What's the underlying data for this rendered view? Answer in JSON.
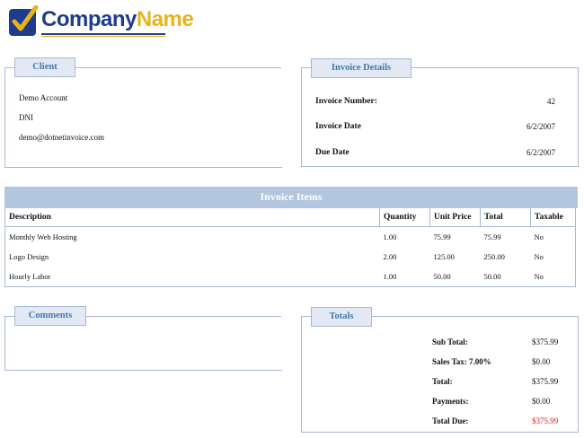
{
  "brand": {
    "company": "Company",
    "name": "Name"
  },
  "client": {
    "tab": "Client",
    "lines": [
      "Demo Account",
      "DNI",
      "demo@dotnetinvoice.com"
    ]
  },
  "invoice_details": {
    "tab": "Invoice Details",
    "rows": [
      {
        "label": "Invoice Number:",
        "value": "42"
      },
      {
        "label": "Invoice Date",
        "value": "6/2/2007"
      },
      {
        "label": "Due Date",
        "value": "6/2/2007"
      }
    ]
  },
  "items": {
    "title": "Invoice Items",
    "columns": [
      "Description",
      "Quantity",
      "Unit Price",
      "Total",
      "Taxable"
    ],
    "rows": [
      [
        "Monthly Web Hosting",
        "1.00",
        "75.99",
        "75.99",
        "No"
      ],
      [
        "Logo Design",
        "2.00",
        "125.00",
        "250.00",
        "No"
      ],
      [
        "Hourly Labor",
        "1.00",
        "50.00",
        "50.00",
        "No"
      ]
    ]
  },
  "comments": {
    "tab": "Comments"
  },
  "totals": {
    "tab": "Totals",
    "rows": [
      {
        "label": "Sub Total:",
        "value": "$375.99"
      },
      {
        "label": "Sales Tax: 7.00%",
        "value": "$0.00"
      },
      {
        "label": "Total:",
        "value": "$375.99"
      },
      {
        "label": "Payments:",
        "value": "$0.00"
      },
      {
        "label": "Total Due:",
        "value": "$375.99"
      }
    ],
    "due_color": "#e02020"
  },
  "colors": {
    "accent": "#3f7aa8",
    "header_band": "#b2c6e0",
    "border": "#a8b6d4",
    "tab_bg": "#e2e9f5"
  },
  "icons": {
    "logo": "checkmark-logo-icon"
  }
}
